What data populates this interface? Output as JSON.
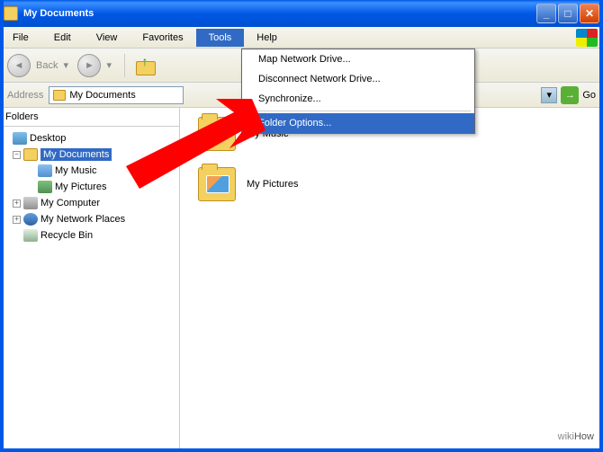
{
  "window": {
    "title": "My Documents"
  },
  "menu": {
    "file": "File",
    "edit": "Edit",
    "view": "View",
    "favorites": "Favorites",
    "tools": "Tools",
    "help": "Help"
  },
  "toolbar": {
    "back": "Back"
  },
  "address": {
    "label": "Address",
    "path": "My Documents",
    "go": "Go"
  },
  "sidebar": {
    "header": "Folders",
    "tree": {
      "desktop": "Desktop",
      "mydocs": "My Documents",
      "mymusic": "My Music",
      "mypics": "My Pictures",
      "mycomp": "My Computer",
      "netplaces": "My Network Places",
      "bin": "Recycle Bin"
    }
  },
  "content": {
    "items": [
      {
        "label": "My Music"
      },
      {
        "label": "My Pictures"
      }
    ]
  },
  "tools_menu": {
    "map_drive": "Map Network Drive...",
    "disconnect": "Disconnect Network Drive...",
    "sync": "Synchronize...",
    "folder_options": "Folder Options..."
  },
  "watermark": {
    "wiki": "wiki",
    "how": "How"
  }
}
